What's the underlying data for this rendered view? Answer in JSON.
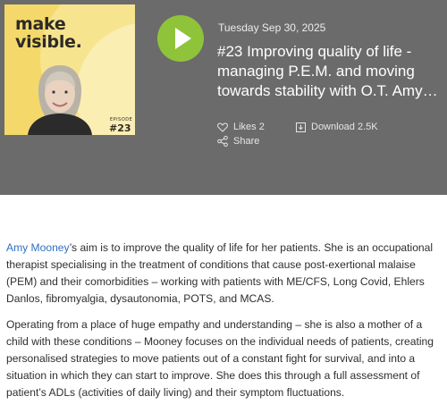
{
  "cover": {
    "brand_line1": "make",
    "brand_line2": "visible.",
    "episode_label": "EPISODE",
    "episode_number": "#23"
  },
  "episode": {
    "date": "Tuesday Sep 30, 2025",
    "title": "#23 Improving quality of life - managing P.E.M. and moving towards stability with O.T. Amy…"
  },
  "actions": {
    "likes": "Likes 2",
    "download": "Download 2.5K",
    "share": "Share"
  },
  "description": {
    "p1_link": "Amy Mooney",
    "p1_rest": "’s aim is to improve the quality of life for her patients.  She is an occupational therapist specialising in the treatment of conditions that cause post-exertional malaise (PEM) and their comorbidities  – working with patients with ME/CFS, Long Covid, Ehlers Danlos, fibromyalgia, dysautonomia, POTS, and MCAS.",
    "p2": "Operating from a place of huge empathy and understanding – she is also a mother of a child with these conditions – Mooney focuses on the individual needs of patients, creating personalised strategies to move patients out of a constant fight for survival, and into a situation in which they can start to improve.  She does this through a full assessment of patient’s ADLs (activities of daily living) and their symptom fluctuations."
  },
  "colors": {
    "header_bg": "#6b6b6b",
    "play_button": "#8fc43a",
    "link": "#2f6fc2",
    "cover_bg": "#f4d96a"
  }
}
